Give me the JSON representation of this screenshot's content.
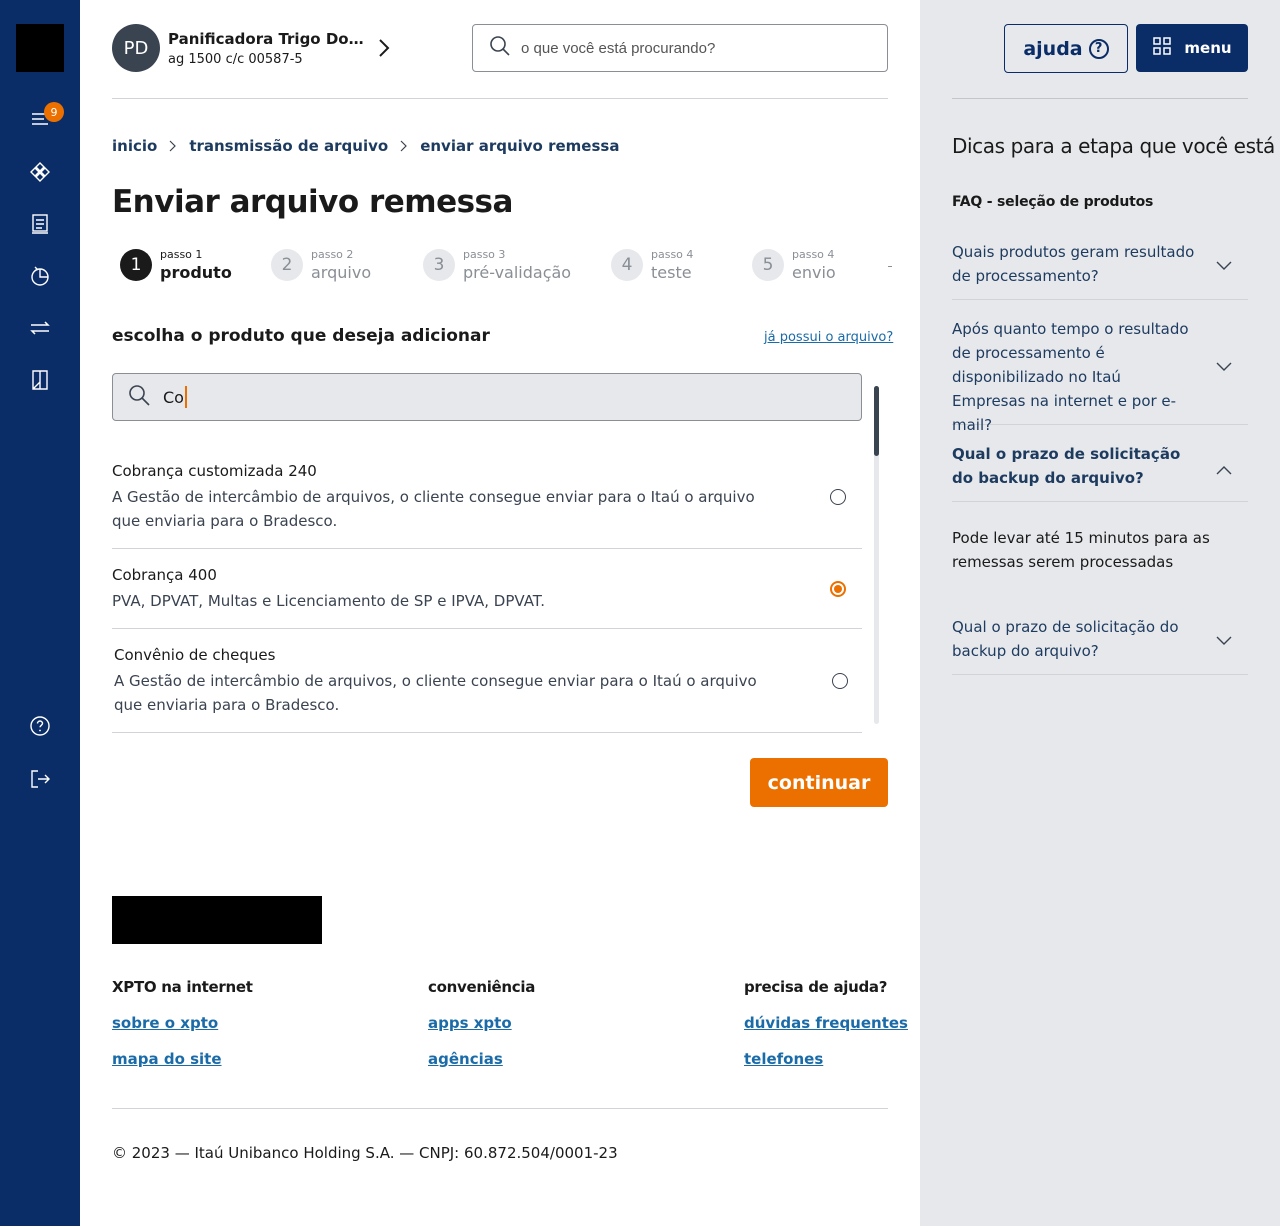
{
  "rail": {
    "notification_count": "9"
  },
  "account": {
    "initials": "PD",
    "name": "Panificadora Trigo Dourado",
    "details": "ag 1500  c/c 00587-5"
  },
  "search": {
    "placeholder": "o que você está procurando?"
  },
  "breadcrumb": [
    "inicio",
    "transmissão de arquivo",
    "enviar arquivo remessa"
  ],
  "page_title": "Enviar arquivo remessa",
  "steps": [
    {
      "number": "1",
      "caption": "passo 1",
      "label": "produto",
      "active": true
    },
    {
      "number": "2",
      "caption": "passo 2",
      "label": "arquivo",
      "active": false
    },
    {
      "number": "3",
      "caption": "passo 3",
      "label": "pré-validação",
      "active": false
    },
    {
      "number": "4",
      "caption": "passo 4",
      "label": "teste",
      "active": false
    },
    {
      "number": "5",
      "caption": "passo 4",
      "label": "envio",
      "active": false
    }
  ],
  "product": {
    "heading": "escolha o produto que deseja adicionar",
    "have_file_link": "já possui o arquivo?",
    "search_value": "Co",
    "items": [
      {
        "title": "Cobrança customizada 240",
        "description": "A Gestão de intercâmbio de arquivos, o cliente consegue enviar para o Itaú o arquivo que enviaria para o Bradesco.",
        "selected": false
      },
      {
        "title": "Cobrança 400",
        "description": "PVA, DPVAT, Multas e Licenciamento de SP e IPVA, DPVAT.",
        "selected": true
      },
      {
        "title": "Convênio de cheques",
        "description": "A Gestão de intercâmbio de arquivos, o cliente consegue enviar para o Itaú o arquivo que enviaria para o Bradesco.",
        "selected": false
      }
    ]
  },
  "continue_label": "continuar",
  "footer": {
    "columns": [
      {
        "heading": "XPTO na internet",
        "links": [
          "sobre o xpto",
          "mapa do site"
        ]
      },
      {
        "heading": "conveniência",
        "links": [
          "apps xpto",
          "agências"
        ]
      },
      {
        "heading": "precisa de ajuda?",
        "links": [
          "dúvidas frequentes",
          "telefones"
        ]
      }
    ],
    "copyright": "© 2023  —  Itaú Unibanco Holding S.A.  —  CNPJ: 60.872.504/0001-23"
  },
  "side": {
    "help_label": "ajuda",
    "menu_label": "menu",
    "tips_title": "Dicas para a etapa que você está",
    "faq_title": "FAQ - seleção de produtos",
    "faqs": [
      {
        "question": "Quais produtos geram resultado de processamento?",
        "expanded": false
      },
      {
        "question": "Após quanto tempo o resultado de processamento é disponibilizado no Itaú Empresas na internet e por e-mail?",
        "expanded": false
      },
      {
        "question": "Qual o prazo de solicitação do backup do arquivo?",
        "expanded": true
      },
      {
        "question": "Qual o prazo de solicitação do backup do arquivo?",
        "expanded": false
      }
    ],
    "open_answer": "Pode levar até 15 minutos para as remessas serem processadas"
  },
  "colors": {
    "rail": "#0a2d68",
    "accent": "#ec7000",
    "link": "#1a6ba8",
    "side_panel": "#e6e8eb"
  }
}
